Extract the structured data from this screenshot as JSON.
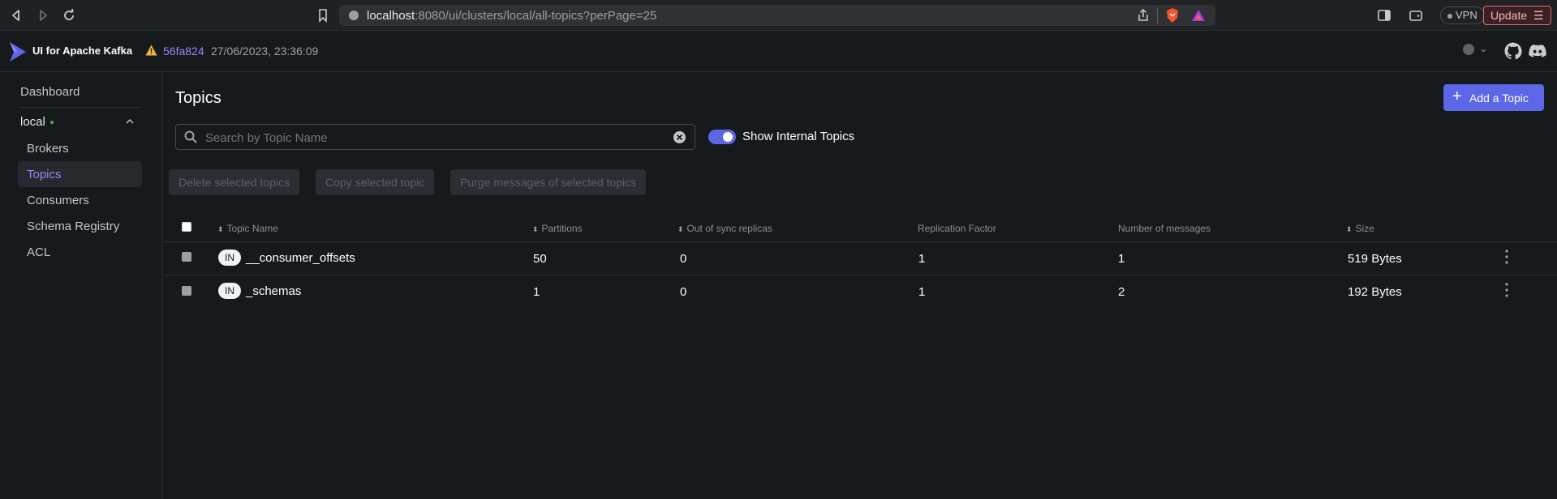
{
  "browser": {
    "url_host": "localhost",
    "url_rest": ":8080/ui/clusters/local/all-topics?perPage=25",
    "vpn_label": "VPN",
    "update_label": "Update"
  },
  "header": {
    "app_title": "UI for Apache Kafka",
    "commit": "56fa824",
    "build_date": "27/06/2023, 23:36:09"
  },
  "sidebar": {
    "dashboard": "Dashboard",
    "cluster": "local",
    "items": [
      "Brokers",
      "Topics",
      "Consumers",
      "Schema Registry",
      "ACL"
    ],
    "active": "Topics"
  },
  "main": {
    "title": "Topics",
    "add_topic_label": "Add a Topic",
    "search_placeholder": "Search by Topic Name",
    "show_internal_label": "Show Internal Topics",
    "show_internal_on": true,
    "bulk_actions": [
      "Delete selected topics",
      "Copy selected topic",
      "Purge messages of selected topics"
    ]
  },
  "table": {
    "columns": [
      "Topic Name",
      "Partitions",
      "Out of sync replicas",
      "Replication Factor",
      "Number of messages",
      "Size"
    ],
    "rows": [
      {
        "badge": "IN",
        "name": "__consumer_offsets",
        "partitions": "50",
        "out_of_sync": "0",
        "replication": "1",
        "messages": "1",
        "size": "519 Bytes"
      },
      {
        "badge": "IN",
        "name": "_schemas",
        "partitions": "1",
        "out_of_sync": "0",
        "replication": "1",
        "messages": "2",
        "size": "192 Bytes"
      }
    ]
  },
  "colors": {
    "accent": "#5b67e6",
    "link": "#8d8bff",
    "background": "#171a1c"
  }
}
